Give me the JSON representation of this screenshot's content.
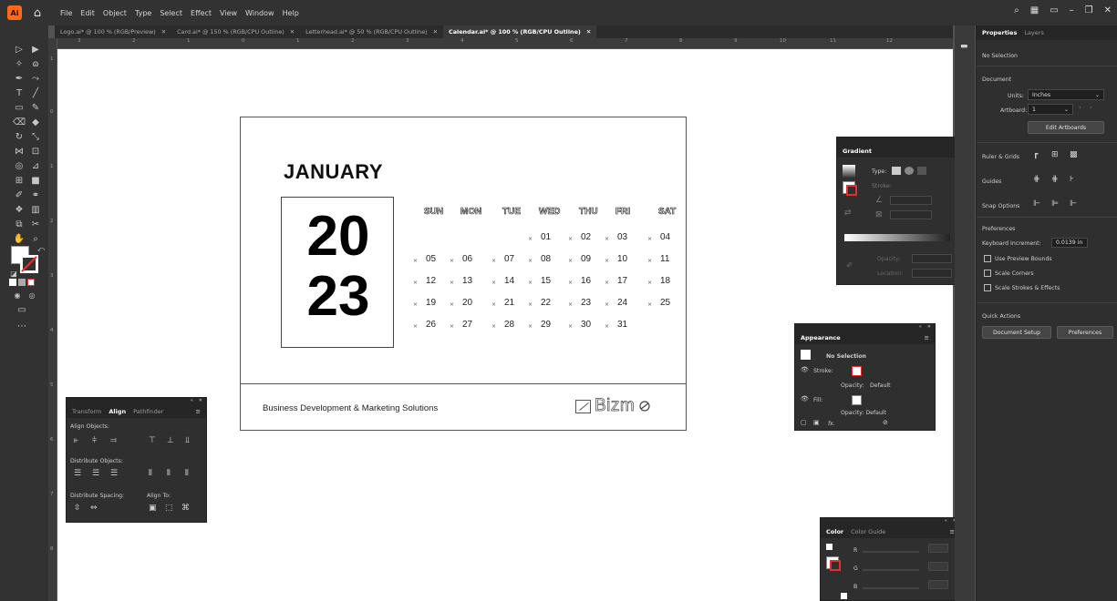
{
  "app": {
    "logo_text": "Ai",
    "home_icon": "home-icon"
  },
  "menu": [
    "File",
    "Edit",
    "Object",
    "Type",
    "Select",
    "Effect",
    "View",
    "Window",
    "Help"
  ],
  "tabs": [
    {
      "label": "Logo.ai* @ 100 % (RGB/Preview)",
      "active": false
    },
    {
      "label": "Card.ai* @ 150 % (RGB/CPU Outline)",
      "active": false
    },
    {
      "label": "Letterhead.ai* @ 50 % (RGB/CPU Outline)",
      "active": false
    },
    {
      "label": "Calendar.ai* @ 100 % (RGB/CPU Outline)",
      "active": true
    }
  ],
  "ruler": {
    "top": [
      "3",
      "2",
      "1",
      "0",
      "1",
      "2",
      "3",
      "4",
      "5",
      "6",
      "7",
      "8",
      "9",
      "10",
      "11",
      "12"
    ],
    "left": [
      "1",
      "0",
      "1",
      "2",
      "3",
      "4",
      "5",
      "6",
      "7",
      "8"
    ]
  },
  "calendar": {
    "month": "JANUARY",
    "year_top": "20",
    "year_bottom": "23",
    "days": [
      "SUN",
      "MON",
      "TUE",
      "WED",
      "THU",
      "FRI",
      "SAT"
    ],
    "weeks": [
      [
        "",
        "",
        "",
        "01",
        "02",
        "03",
        "04"
      ],
      [
        "05",
        "06",
        "07",
        "08",
        "09",
        "10",
        "11"
      ],
      [
        "12",
        "13",
        "14",
        "15",
        "16",
        "17",
        "18"
      ],
      [
        "19",
        "20",
        "21",
        "22",
        "23",
        "24",
        "25"
      ],
      [
        "26",
        "27",
        "28",
        "29",
        "30",
        "31",
        ""
      ]
    ],
    "footer_text": "Business Development & Marketing Solutions",
    "logo_text": "Bizm"
  },
  "transform_panel": {
    "tabs": [
      "Transform",
      "Align",
      "Pathfinder"
    ],
    "active": "Align",
    "align_objects": "Align Objects:",
    "distribute_objects": "Distribute Objects:",
    "distribute_spacing": "Distribute Spacing:",
    "align_to": "Align To:"
  },
  "gradient_panel": {
    "title": "Gradient",
    "type_label": "Type:",
    "stroke_label": "Stroke:",
    "opacity_label": "Opacity:",
    "location_label": "Location:"
  },
  "appearance_panel": {
    "title": "Appearance",
    "no_selection": "No Selection",
    "stroke_label": "Stroke:",
    "opacity_label": "Opacity:",
    "opacity_value": "Default",
    "fill_label": "Fill:",
    "fill_opacity": "Opacity: Default",
    "fx": "fx."
  },
  "color_panel": {
    "tabs": [
      "Color",
      "Color Guide"
    ],
    "channels": [
      "R",
      "G",
      "B"
    ]
  },
  "properties": {
    "tabs": [
      "Properties",
      "Layers"
    ],
    "selection": "No Selection",
    "document_label": "Document",
    "units_label": "Units:",
    "units_value": "Inches",
    "artboard_label": "Artboard:",
    "artboard_value": "1",
    "edit_artboards": "Edit Artboards",
    "rulers_grids": "Ruler & Grids",
    "guides": "Guides",
    "snap_options": "Snap Options",
    "preferences_label": "Preferences",
    "keyboard_increment_label": "Keyboard Increment:",
    "keyboard_increment_value": "0.0139 in",
    "use_preview_bounds": "Use Preview Bounds",
    "scale_corners": "Scale Corners",
    "scale_strokes": "Scale Strokes & Effects",
    "quick_actions": "Quick Actions",
    "document_setup": "Document Setup",
    "preferences_button": "Preferences"
  }
}
